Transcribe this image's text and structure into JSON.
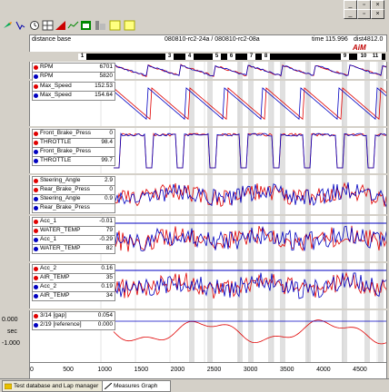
{
  "header": {
    "left": "distance base",
    "center": "080810-rc2-24a  /  080810-rc2-08a",
    "time_label": "time",
    "time_value": "115.996",
    "dist_label": "dist",
    "dist_value": "4812.0"
  },
  "brand": "AiM",
  "laps": [
    "1",
    "3",
    "4",
    "5",
    "6",
    "7",
    "8",
    "9",
    "10",
    "11"
  ],
  "panels": [
    {
      "rows": [
        {
          "name": "RPM",
          "value": "6701",
          "color": "#e00000"
        },
        {
          "name": "RPM",
          "value": "5820",
          "color": "#0000c0"
        }
      ]
    },
    {
      "rows": [
        {
          "name": "Max_Speed",
          "value": "152.53",
          "color": "#e00000"
        },
        {
          "name": "Max_Speed",
          "value": "154.64",
          "color": "#0000c0"
        }
      ]
    },
    {
      "rows": [
        {
          "name": "Front_Brake_Press",
          "value": "0",
          "color": "#e00000"
        },
        {
          "name": "THROTTLE",
          "value": "98.4",
          "color": "#e00000"
        },
        {
          "name": "Front_Brake_Press",
          "value": "",
          "color": "#0000c0"
        },
        {
          "name": "THROTTLE",
          "value": "99.7",
          "color": "#0000c0"
        }
      ]
    },
    {
      "rows": [
        {
          "name": "Steering_Angle",
          "value": "2.9",
          "color": "#e00000"
        },
        {
          "name": "Rear_Brake_Press",
          "value": "0",
          "color": "#e00000"
        },
        {
          "name": "Steering_Angle",
          "value": "0.9",
          "color": "#0000c0"
        },
        {
          "name": "Rear_Brake_Press",
          "value": "",
          "color": "#0000c0"
        }
      ]
    },
    {
      "rows": [
        {
          "name": "Acc_1",
          "value": "-0.01",
          "color": "#e00000"
        },
        {
          "name": "WATER_TEMP",
          "value": "79",
          "color": "#e00000"
        },
        {
          "name": "Acc_1",
          "value": "-0.29",
          "color": "#0000c0"
        },
        {
          "name": "WATER_TEMP",
          "value": "82",
          "color": "#0000c0"
        }
      ]
    },
    {
      "rows": [
        {
          "name": "Acc_2",
          "value": "0.16",
          "color": "#e00000"
        },
        {
          "name": "AIR_TEMP",
          "value": "35",
          "color": "#e00000"
        },
        {
          "name": "Acc_2",
          "value": "0.19",
          "color": "#0000c0"
        },
        {
          "name": "AIR_TEMP",
          "value": "34",
          "color": "#0000c0"
        }
      ]
    },
    {
      "rows": [
        {
          "name": "3/14 [gap]",
          "value": "0.054",
          "color": "#e00000"
        },
        {
          "name": "2/19 [reference]",
          "value": "0.000",
          "color": "#0000c0"
        }
      ]
    }
  ],
  "yaxis": {
    "top": "0.000",
    "unit": "sec",
    "bottom": "-1.000"
  },
  "xaxis": {
    "ticks": [
      "0",
      "500",
      "1000",
      "1500",
      "2000",
      "2500",
      "3000",
      "3500",
      "4000",
      "4500"
    ],
    "max": 4812
  },
  "tabs": [
    {
      "label": "Test database and Lap manager"
    },
    {
      "label": "Measures Graph"
    }
  ]
}
